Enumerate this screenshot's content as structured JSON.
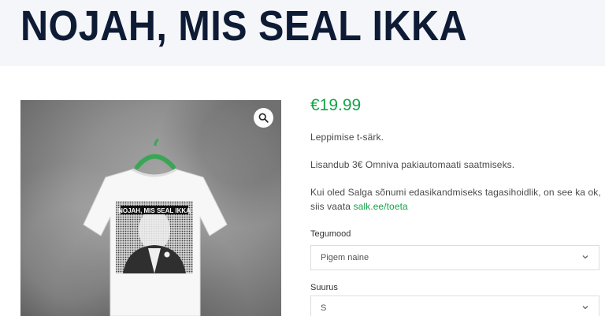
{
  "page": {
    "title": "NOJAH, MIS SEAL IKKA"
  },
  "product": {
    "price": "€19.99",
    "description_1": "Leppimise t-särk.",
    "description_2": "Lisandub 3€ Omniva pakiautomaati saatmiseks.",
    "description_3_line1": "Kui oled Salga sõnumi edasikandmiseks tagasihoidlik, on see ka ok,",
    "description_3_line2_prefix": "siis vaata",
    "description_3_link": "salk.ee/toeta",
    "shirt_print_text": "NOJAH, MIS SEAL IKKA",
    "image_icon": "zoom-icon"
  },
  "options": {
    "style_label": "Tegumood",
    "style_value": "Pigem naine",
    "size_label": "Suurus",
    "size_value": "S"
  },
  "colors": {
    "title": "#0e1b35",
    "price": "#16a34a",
    "link": "#16a34a",
    "hanger": "#3aa655"
  }
}
